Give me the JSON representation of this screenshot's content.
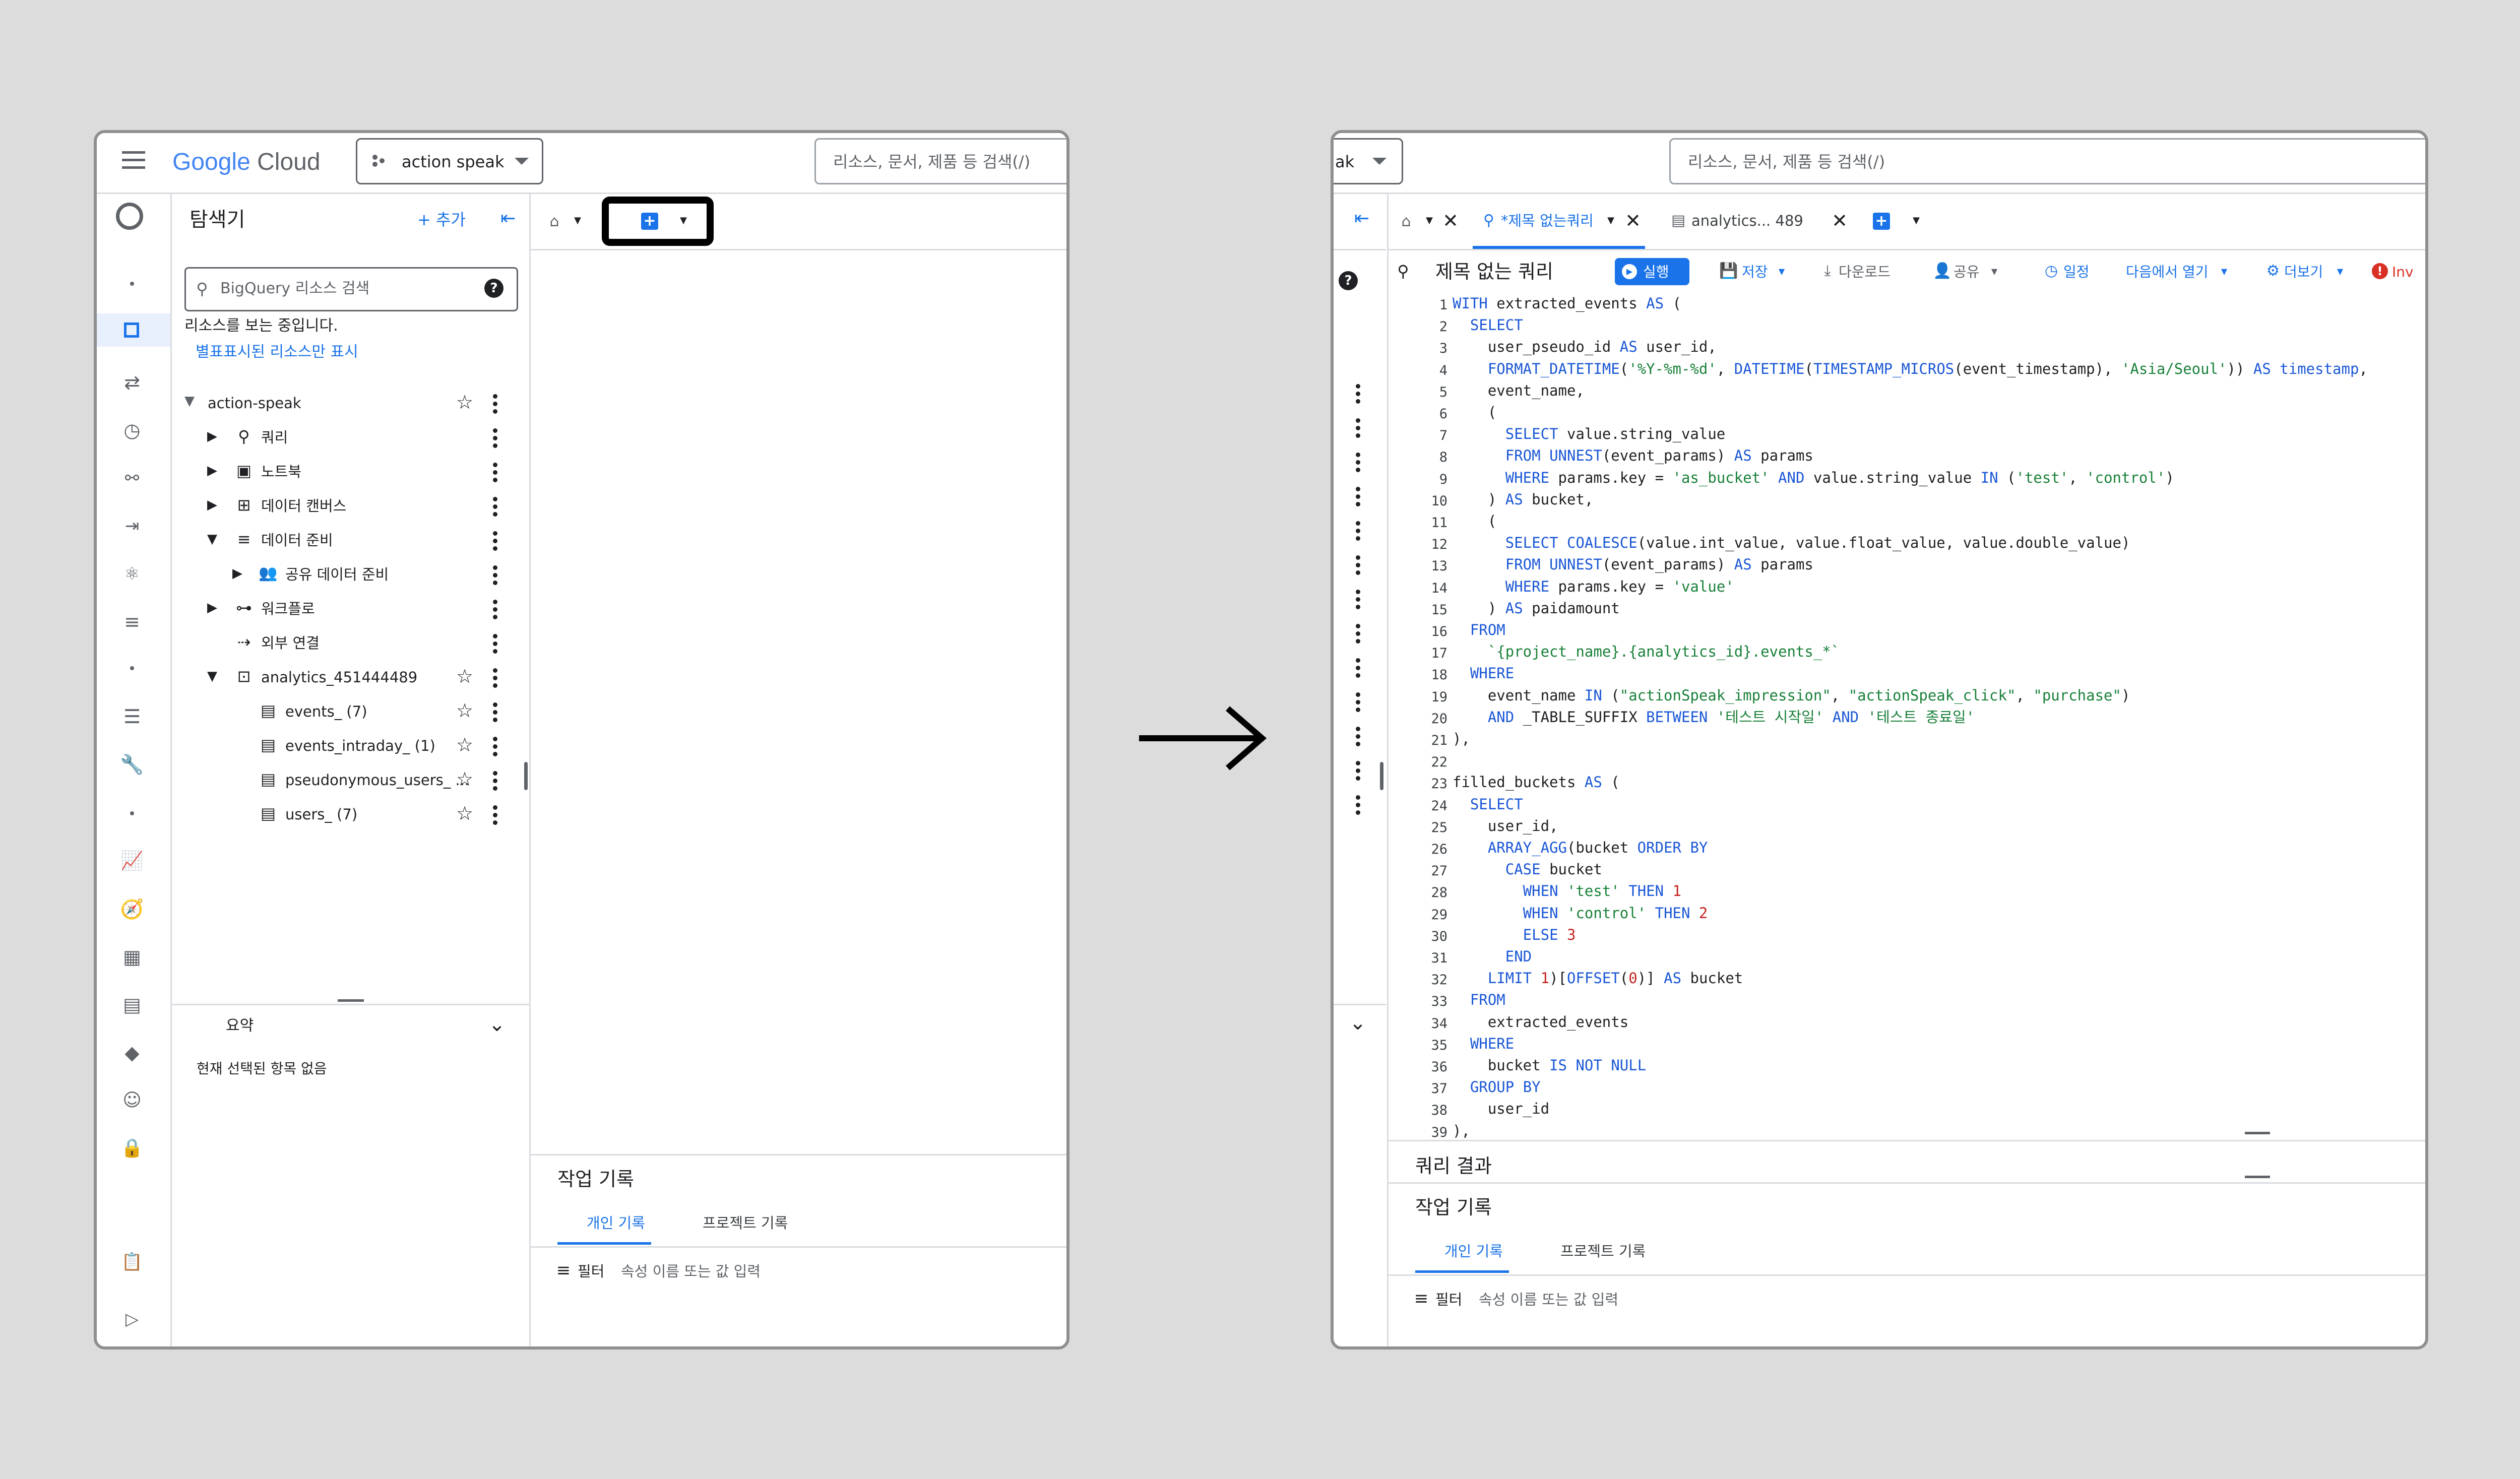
{
  "left": {
    "brand": {
      "google": "Google",
      "cloud": "Cloud"
    },
    "project": "action speak",
    "search_placeholder": "리소스, 문서, 제품 등 검색(/)",
    "explorer": {
      "title": "탐색기",
      "add": "+ 추가",
      "search_placeholder": "BigQuery 리소스 검색",
      "viewing": "리소스를 보는 중입니다.",
      "starred_only": "별표표시된 리소스만 표시"
    },
    "tree": {
      "root": "action-speak",
      "items": [
        "쿼리",
        "노트북",
        "데이터 캔버스",
        "데이터 준비",
        "공유 데이터 준비",
        "워크플로",
        "외부 연결"
      ],
      "dataset": "analytics_451444489",
      "tables": [
        "events_ (7)",
        "events_intraday_ (1)",
        "pseudonymous_users_ ...",
        "users_ (7)"
      ]
    },
    "summary": {
      "title": "요약",
      "empty": "현재 선택된 항목 없음"
    },
    "job_history": {
      "title": "작업 기록",
      "tab_personal": "개인 기록",
      "tab_project": "프로젝트 기록",
      "filter": "필터",
      "filter_placeholder": "속성 이름 또는 값 입력"
    }
  },
  "right": {
    "project_fragment": "ak",
    "search_placeholder": "리소스, 문서, 제품 등 검색(/)",
    "tabs": {
      "query": "*제목 없는쿼리",
      "table": "analytics... 489"
    },
    "editor": {
      "title": "제목 없는 쿼리",
      "run": "실행",
      "save": "저장",
      "download": "다운로드",
      "share": "공유",
      "schedule": "일정",
      "open_in": "다음에서 열기",
      "more": "더보기",
      "invalid": "Inv"
    },
    "query_results": "쿼리 결과",
    "job_history": {
      "title": "작업 기록",
      "tab_personal": "개인 기록",
      "tab_project": "프로젝트 기록",
      "filter": "필터",
      "filter_placeholder": "속성 이름 또는 값 입력"
    }
  },
  "code_lines": [
    "WITH extracted_events AS (",
    "  SELECT",
    "    user_pseudo_id AS user_id,",
    "    FORMAT_DATETIME('%Y-%m-%d', DATETIME(TIMESTAMP_MICROS(event_timestamp), 'Asia/Seoul')) AS timestamp,",
    "    event_name,",
    "    (",
    "      SELECT value.string_value",
    "      FROM UNNEST(event_params) AS params",
    "      WHERE params.key = 'as_bucket' AND value.string_value IN ('test', 'control')",
    "    ) AS bucket,",
    "    (",
    "      SELECT COALESCE(value.int_value, value.float_value, value.double_value)",
    "      FROM UNNEST(event_params) AS params",
    "      WHERE params.key = 'value'",
    "    ) AS paidamount",
    "  FROM",
    "    `{project_name}.{analytics_id}.events_*`",
    "  WHERE",
    "    event_name IN (\"actionSpeak_impression\", \"actionSpeak_click\", \"purchase\")",
    "    AND _TABLE_SUFFIX BETWEEN '테스트 시작일' AND '테스트 종료일'",
    "),",
    "",
    "filled_buckets AS (",
    "  SELECT",
    "    user_id,",
    "    ARRAY_AGG(bucket ORDER BY",
    "      CASE bucket",
    "        WHEN 'test' THEN 1",
    "        WHEN 'control' THEN 2",
    "        ELSE 3",
    "      END",
    "    LIMIT 1)[OFFSET(0)] AS bucket",
    "  FROM",
    "    extracted_events",
    "  WHERE",
    "    bucket IS NOT NULL",
    "  GROUP BY",
    "    user_id",
    "),"
  ],
  "colors": {
    "accent": "#1a73e8",
    "keyword": "#1a57d6",
    "string": "#188038",
    "number": "#c5221f",
    "border": "#dadce0"
  },
  "icons": [
    "hamburger-icon",
    "search-icon",
    "help-icon",
    "star-icon",
    "kebab-icon",
    "chevron-down-icon",
    "arrow-right-icon",
    "close-icon",
    "home-icon",
    "plus-box-icon"
  ]
}
